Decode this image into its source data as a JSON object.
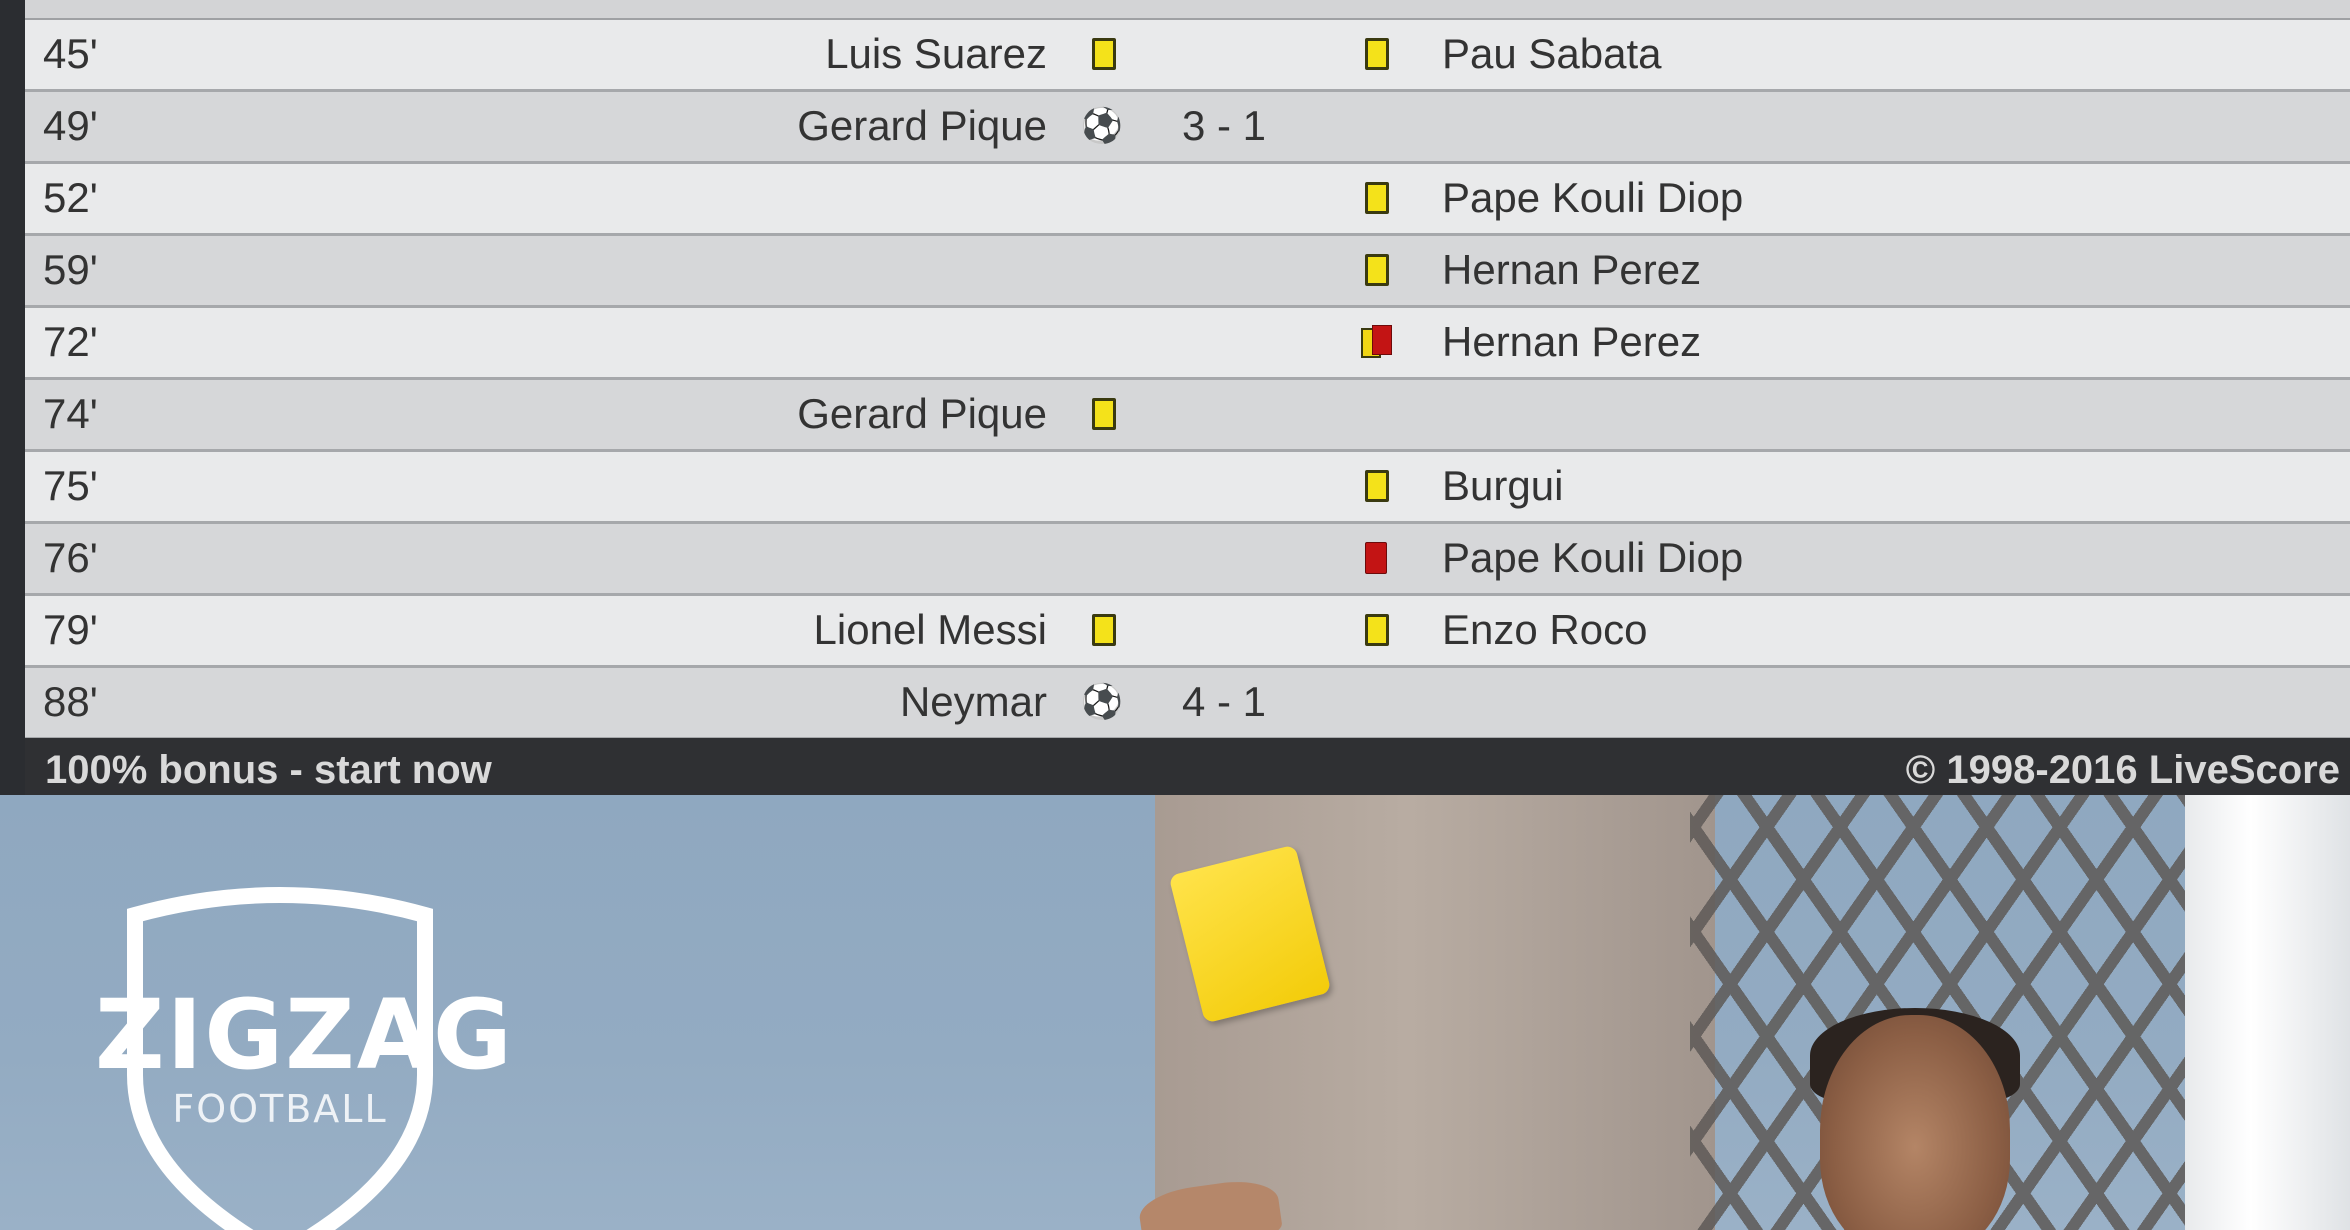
{
  "events": [
    {
      "minute": "45'",
      "home_player": "Luis Suarez",
      "home_icon": "yellow-card",
      "score": "",
      "away_icon": "yellow-card",
      "away_player": "Pau Sabata",
      "shade": "light"
    },
    {
      "minute": "49'",
      "home_player": "Gerard Pique",
      "home_icon": "goal",
      "score": "3 - 1",
      "away_icon": "",
      "away_player": "",
      "shade": "dark"
    },
    {
      "minute": "52'",
      "home_player": "",
      "home_icon": "",
      "score": "",
      "away_icon": "yellow-card",
      "away_player": "Pape Kouli Diop",
      "shade": "light"
    },
    {
      "minute": "59'",
      "home_player": "",
      "home_icon": "",
      "score": "",
      "away_icon": "yellow-card",
      "away_player": "Hernan Perez",
      "shade": "dark"
    },
    {
      "minute": "72'",
      "home_player": "",
      "home_icon": "",
      "score": "",
      "away_icon": "second-yellow-red-card",
      "away_player": "Hernan Perez",
      "shade": "light"
    },
    {
      "minute": "74'",
      "home_player": "Gerard Pique",
      "home_icon": "yellow-card",
      "score": "",
      "away_icon": "",
      "away_player": "",
      "shade": "dark"
    },
    {
      "minute": "75'",
      "home_player": "",
      "home_icon": "",
      "score": "",
      "away_icon": "yellow-card",
      "away_player": "Burgui",
      "shade": "light"
    },
    {
      "minute": "76'",
      "home_player": "",
      "home_icon": "",
      "score": "",
      "away_icon": "red-card",
      "away_player": "Pape Kouli Diop",
      "shade": "dark"
    },
    {
      "minute": "79'",
      "home_player": "Lionel Messi",
      "home_icon": "yellow-card",
      "score": "",
      "away_icon": "yellow-card",
      "away_player": "Enzo Roco",
      "shade": "light"
    },
    {
      "minute": "88'",
      "home_player": "Neymar",
      "home_icon": "goal",
      "score": "4 - 1",
      "away_icon": "",
      "away_player": "",
      "shade": "dark"
    }
  ],
  "footer": {
    "promo_link": "100% bonus - start now",
    "copyright": "© 1998-2016 LiveScore"
  },
  "ad": {
    "brand": "ZIGZAG",
    "brand_sub": "FOOTBALL",
    "icons": [
      "shield-logo-icon",
      "yellow-card-icon"
    ]
  },
  "colors": {
    "yellow_card": "#f4e21a",
    "red_card": "#c31414",
    "row_light": "#e9eaeb",
    "row_dark": "#d6d7d9",
    "footer_bg": "#2f3033"
  }
}
